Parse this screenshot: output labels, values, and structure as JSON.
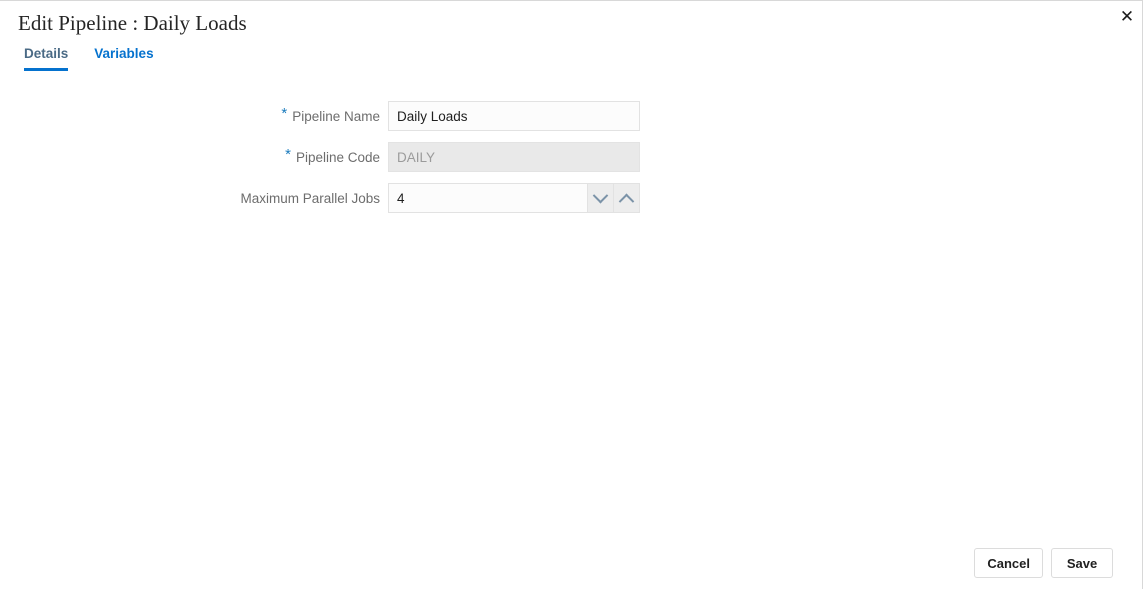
{
  "dialog": {
    "title": "Edit Pipeline : Daily Loads",
    "close_icon": "close-icon"
  },
  "tabs": [
    {
      "label": "Details",
      "active": true
    },
    {
      "label": "Variables",
      "active": false
    }
  ],
  "form": {
    "required_marker": "*",
    "fields": [
      {
        "label": "Pipeline Name",
        "value": "Daily Loads",
        "placeholder": "",
        "required": true,
        "disabled": false
      },
      {
        "label": "Pipeline Code",
        "value": "DAILY",
        "placeholder": "",
        "required": true,
        "disabled": true
      },
      {
        "label": "Maximum Parallel Jobs",
        "value": "4",
        "placeholder": "",
        "required": false,
        "disabled": false,
        "spinner": {
          "down_icon": "chevron-down-icon",
          "up_icon": "chevron-up-icon"
        }
      }
    ]
  },
  "footer": {
    "cancel_label": "Cancel",
    "save_label": "Save"
  },
  "colors": {
    "accent": "#0572ce",
    "tab_active_text": "#4a6a85",
    "required_star": "#1a7bbd",
    "label_text": "#6d6d6d",
    "disabled_bg": "#e9e9e9",
    "input_bg": "#fcfcfc"
  }
}
